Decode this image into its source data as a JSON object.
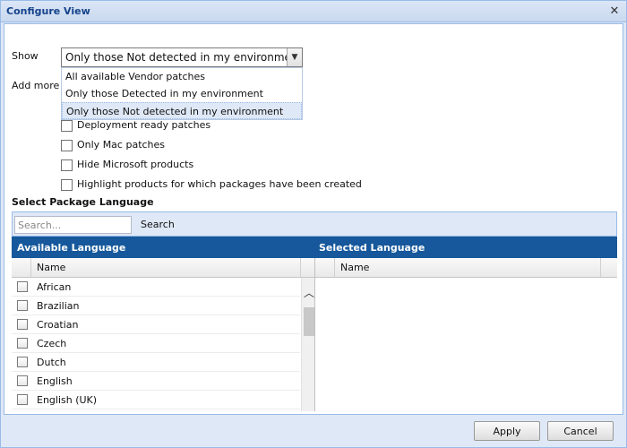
{
  "window": {
    "title": "Configure View"
  },
  "show": {
    "label": "Show",
    "selected": "Only those Not detected in my environment",
    "options": [
      "All available Vendor patches",
      "Only those Detected in my environment",
      "Only those Not detected in my environment"
    ]
  },
  "filters": {
    "label": "Add more f",
    "items": [
      {
        "label": "Deployment ready patches",
        "checked": false
      },
      {
        "label": "Only Mac patches",
        "checked": false
      },
      {
        "label": "Hide Microsoft products",
        "checked": false
      },
      {
        "label": "Highlight products for which packages have been created",
        "checked": false
      }
    ]
  },
  "language": {
    "section_title": "Select Package Language",
    "search_placeholder": "Search...",
    "search_button": "Search",
    "available_title": "Available Language",
    "selected_title": "Selected Language",
    "column_name": "Name",
    "available": [
      "African",
      "Brazilian",
      "Croatian",
      "Czech",
      "Dutch",
      "English",
      "English (UK)"
    ]
  },
  "footer": {
    "apply": "Apply",
    "cancel": "Cancel"
  }
}
